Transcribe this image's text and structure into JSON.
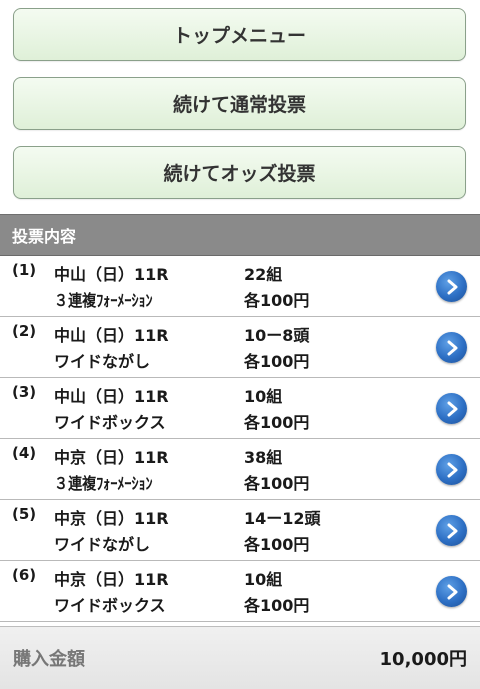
{
  "buttons": {
    "top_menu": "トップメニュー",
    "continue_normal": "続けて通常投票",
    "continue_odds": "続けてオッズ投票"
  },
  "section": {
    "title": "投票内容"
  },
  "bets": [
    {
      "num": "(1)",
      "race": "中山（日）11R",
      "type": "３連複ﾌｫｰﾒｰｼｮﾝ",
      "count": "22組",
      "unit": "各100円"
    },
    {
      "num": "(2)",
      "race": "中山（日）11R",
      "type": "ワイドながし",
      "count": "10ー8頭",
      "unit": "各100円"
    },
    {
      "num": "(3)",
      "race": "中山（日）11R",
      "type": "ワイドボックス",
      "count": "10組",
      "unit": "各100円"
    },
    {
      "num": "(4)",
      "race": "中京（日）11R",
      "type": "３連複ﾌｫｰﾒｰｼｮﾝ",
      "count": "38組",
      "unit": "各100円"
    },
    {
      "num": "(5)",
      "race": "中京（日）11R",
      "type": "ワイドながし",
      "count": "14ー12頭",
      "unit": "各100円"
    },
    {
      "num": "(6)",
      "race": "中京（日）11R",
      "type": "ワイドボックス",
      "count": "10組",
      "unit": "各100円"
    }
  ],
  "total": {
    "label": "購入金額",
    "amount": "10,000円"
  },
  "icons": {
    "row_arrow": "chevron-right-circle-icon"
  },
  "colors": {
    "button_bg": "#dff0d8",
    "header_bg": "#8a8a8a",
    "arrow_blue": "#2d6fc4"
  }
}
